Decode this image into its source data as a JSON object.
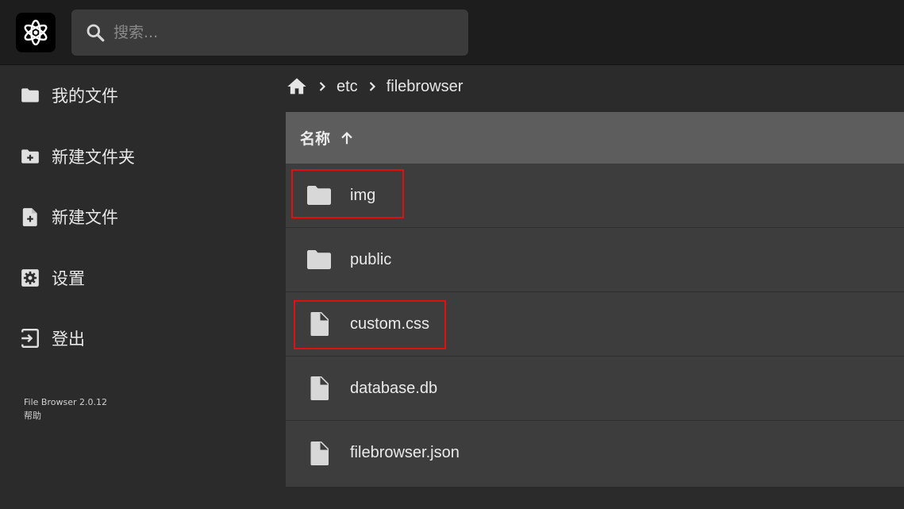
{
  "header": {
    "logo_icon": "atom-logo-icon",
    "search_placeholder": "搜索..."
  },
  "sidebar": {
    "items": [
      {
        "label": "我的文件",
        "icon": "folder-icon"
      },
      {
        "label": "新建文件夹",
        "icon": "new-folder-icon"
      },
      {
        "label": "新建文件",
        "icon": "new-file-icon"
      },
      {
        "label": "设置",
        "icon": "settings-icon"
      },
      {
        "label": "登出",
        "icon": "logout-icon"
      }
    ],
    "version": "File Browser 2.0.12",
    "help": "帮助"
  },
  "breadcrumb": {
    "home_icon": "home-icon",
    "parts": [
      "etc",
      "filebrowser"
    ]
  },
  "list": {
    "header_label": "名称",
    "sort_icon": "arrow-up-icon",
    "items": [
      {
        "name": "img",
        "type": "folder",
        "highlighted": true
      },
      {
        "name": "public",
        "type": "folder",
        "highlighted": false
      },
      {
        "name": "custom.css",
        "type": "file",
        "highlighted": true
      },
      {
        "name": "database.db",
        "type": "file",
        "highlighted": false
      },
      {
        "name": "filebrowser.json",
        "type": "file",
        "highlighted": false
      }
    ]
  },
  "colors": {
    "header_bg": "#1d1d1d",
    "body_bg": "#2b2b2b",
    "list_bg": "#3d3d3d",
    "list_header_bg": "#5d5d5d",
    "highlight": "#e01010"
  }
}
